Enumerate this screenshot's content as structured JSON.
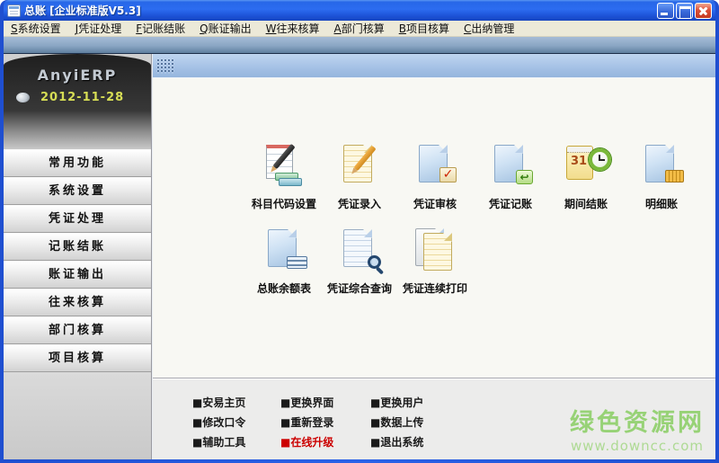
{
  "window": {
    "title": "总账 [企业标准版V5.3]",
    "controls": {
      "minimize": "minimize-button",
      "maximize": "maximize-button",
      "close": "close-button"
    }
  },
  "menu": {
    "items": [
      {
        "accel": "S",
        "text": "系统设置"
      },
      {
        "accel": "J",
        "text": "凭证处理"
      },
      {
        "accel": "F",
        "text": "记账结账"
      },
      {
        "accel": "Q",
        "text": "账证输出"
      },
      {
        "accel": "W",
        "text": "往来核算"
      },
      {
        "accel": "A",
        "text": "部门核算"
      },
      {
        "accel": "B",
        "text": "项目核算"
      },
      {
        "accel": "C",
        "text": "出纳管理"
      }
    ]
  },
  "sidebar": {
    "logo": "AnyiERP",
    "date": "2012-11-28",
    "items": [
      {
        "label": "常用功能"
      },
      {
        "label": "系统设置"
      },
      {
        "label": "凭证处理"
      },
      {
        "label": "记账结账"
      },
      {
        "label": "账证输出"
      },
      {
        "label": "往来核算"
      },
      {
        "label": "部门核算"
      },
      {
        "label": "项目核算"
      }
    ]
  },
  "main": {
    "icons": [
      {
        "label": "科目代码设置",
        "icon": "notepad-pencil-money-icon"
      },
      {
        "label": "凭证录入",
        "icon": "document-pencil-icon"
      },
      {
        "label": "凭证审核",
        "icon": "document-check-icon"
      },
      {
        "label": "凭证记账",
        "icon": "document-post-icon"
      },
      {
        "label": "期间结账",
        "icon": "calendar-clock-icon",
        "calendar_day": "31"
      },
      {
        "label": "明细账",
        "icon": "document-abacus-icon"
      },
      {
        "label": "总账余额表",
        "icon": "document-table-icon"
      },
      {
        "label": "凭证综合查询",
        "icon": "document-magnifier-icon"
      },
      {
        "label": "凭证连续打印",
        "icon": "documents-stack-icon"
      }
    ]
  },
  "footer": {
    "columns": [
      {
        "links": [
          {
            "label": "■安易主页"
          },
          {
            "label": "■修改口令"
          },
          {
            "label": "■辅助工具"
          }
        ]
      },
      {
        "links": [
          {
            "label": "■更换界面"
          },
          {
            "label": "■重新登录"
          },
          {
            "label": "■在线升级"
          }
        ]
      },
      {
        "links": [
          {
            "label": "■更换用户"
          },
          {
            "label": "■数据上传"
          },
          {
            "label": "■退出系统"
          }
        ]
      }
    ],
    "highlight_color": "#cc0000"
  },
  "watermark": {
    "site": "绿色资源网",
    "url": "www.downcc.com"
  },
  "colors": {
    "titlebar_blue": "#2161de",
    "menu_bg": "#ece9d8",
    "steel_band": "#8aa6c4",
    "sidebar_dark": "#2e2e2e",
    "date_yellow": "#d6dd55",
    "main_band_blue": "#a6c2e6",
    "content_bg": "#f8f8f3",
    "footer_bg": "#ececeb",
    "link_red": "#cc0000",
    "watermark_green": "#97d276"
  }
}
